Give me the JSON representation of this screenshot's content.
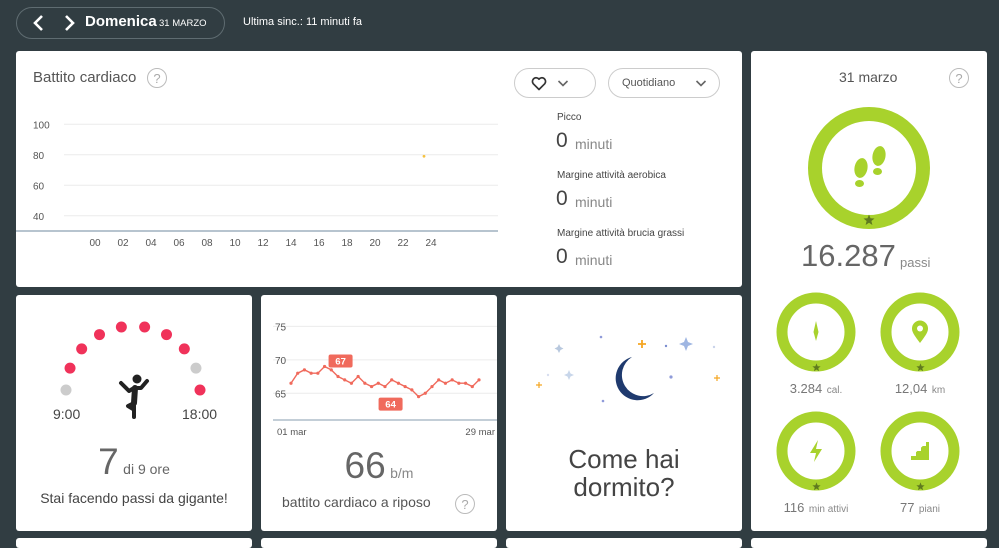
{
  "header": {
    "day": "Domenica",
    "date": "31 MARZO",
    "sync": "Ultima sinc.: 11 minuti fa"
  },
  "heart_card": {
    "title": "Battito cardiaco",
    "help": "?",
    "period": "Quotidiano",
    "stats": [
      {
        "label": "Picco",
        "value": "0",
        "unit": "minuti"
      },
      {
        "label": "Margine attività aerobica",
        "value": "0",
        "unit": "minuti"
      },
      {
        "label": "Margine attività brucia grassi",
        "value": "0",
        "unit": "minuti"
      }
    ]
  },
  "hr_chart": {
    "chart_data": {
      "type": "line",
      "y_ticks": [
        "100",
        "80",
        "60",
        "40"
      ],
      "x_ticks": [
        "00",
        "02",
        "04",
        "06",
        "08",
        "10",
        "12",
        "14",
        "16",
        "18",
        "20",
        "22",
        "24"
      ],
      "ylim": [
        30,
        110
      ],
      "xlim": [
        -1.5,
        26.5
      ],
      "points": [
        {
          "x": 23.5,
          "y": 79
        }
      ]
    }
  },
  "steps_card": {
    "date": "31 marzo",
    "help": "?",
    "steps_value": "16.287",
    "steps_unit": "passi",
    "calories_value": "3.284",
    "calories_unit": "cal.",
    "distance_value": "12,04",
    "distance_unit": "km",
    "active_value": "116",
    "active_unit": "min attivi",
    "floors_value": "77",
    "floors_unit": "piani",
    "accent": "#a8d22c"
  },
  "hourly_card": {
    "start_time": "9:00",
    "end_time": "18:00",
    "value": "7",
    "of_text": "di 9 ore",
    "message": "Stai facendo passi da gigante!",
    "active_color": "#f0325a",
    "inactive_color": "#cccccc",
    "dots": [
      false,
      true,
      true,
      true,
      true,
      true,
      true,
      true,
      false,
      true
    ]
  },
  "resting_card": {
    "value": "66",
    "unit": "b/m",
    "label": "battito cardiaco a riposo",
    "help": "?",
    "chart_data": {
      "type": "line",
      "y_ticks": [
        "75",
        "70",
        "65"
      ],
      "x_start_label": "01 mar",
      "x_end_label": "29 mar",
      "ylim": [
        61,
        77
      ],
      "values": [
        66.5,
        68,
        68.5,
        68,
        68,
        69,
        68.5,
        67.5,
        67,
        66.5,
        67.5,
        66.5,
        66,
        66.5,
        66,
        67,
        66.5,
        66,
        65.5,
        64.5,
        65,
        66,
        67,
        66.5,
        67,
        66.5,
        66.5,
        66,
        67
      ],
      "label_high": "67",
      "label_low": "64",
      "line_color": "#f06a5c"
    }
  },
  "sleep_card": {
    "line1": "Come hai",
    "line2": "dormito?"
  }
}
